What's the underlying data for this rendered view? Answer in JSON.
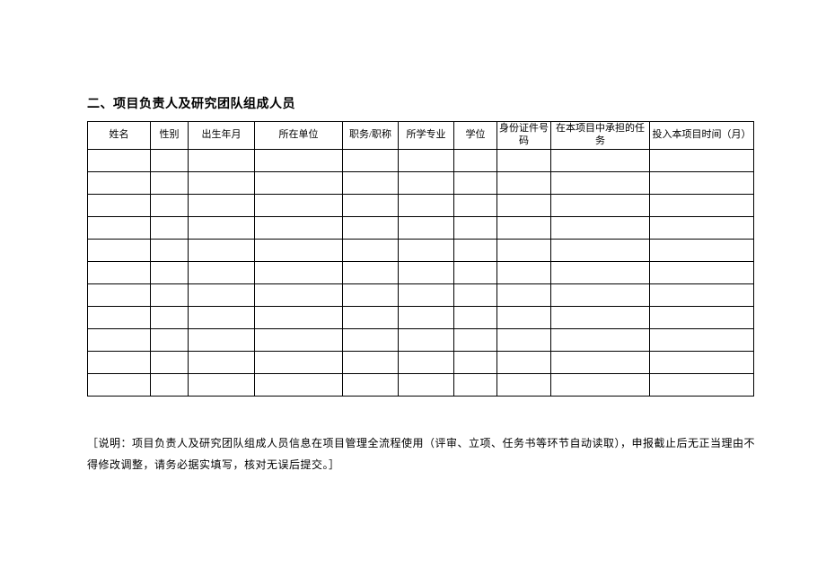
{
  "section_title": "二、项目负责人及研究团队组成人员",
  "headers": {
    "name": "姓名",
    "sex": "性别",
    "dob": "出生年月",
    "unit": "所在单位",
    "position": "职务/职称",
    "major": "所学专业",
    "degree": "学位",
    "idno": "身份证件号码",
    "role": "在本项目中承担的任务",
    "time": "投入本项目时间（月）"
  },
  "rows": [
    {
      "name": "",
      "sex": "",
      "dob": "",
      "unit": "",
      "position": "",
      "major": "",
      "degree": "",
      "idno": "",
      "role": "",
      "time": ""
    },
    {
      "name": "",
      "sex": "",
      "dob": "",
      "unit": "",
      "position": "",
      "major": "",
      "degree": "",
      "idno": "",
      "role": "",
      "time": ""
    },
    {
      "name": "",
      "sex": "",
      "dob": "",
      "unit": "",
      "position": "",
      "major": "",
      "degree": "",
      "idno": "",
      "role": "",
      "time": ""
    },
    {
      "name": "",
      "sex": "",
      "dob": "",
      "unit": "",
      "position": "",
      "major": "",
      "degree": "",
      "idno": "",
      "role": "",
      "time": ""
    },
    {
      "name": "",
      "sex": "",
      "dob": "",
      "unit": "",
      "position": "",
      "major": "",
      "degree": "",
      "idno": "",
      "role": "",
      "time": ""
    },
    {
      "name": "",
      "sex": "",
      "dob": "",
      "unit": "",
      "position": "",
      "major": "",
      "degree": "",
      "idno": "",
      "role": "",
      "time": ""
    },
    {
      "name": "",
      "sex": "",
      "dob": "",
      "unit": "",
      "position": "",
      "major": "",
      "degree": "",
      "idno": "",
      "role": "",
      "time": ""
    },
    {
      "name": "",
      "sex": "",
      "dob": "",
      "unit": "",
      "position": "",
      "major": "",
      "degree": "",
      "idno": "",
      "role": "",
      "time": ""
    },
    {
      "name": "",
      "sex": "",
      "dob": "",
      "unit": "",
      "position": "",
      "major": "",
      "degree": "",
      "idno": "",
      "role": "",
      "time": ""
    },
    {
      "name": "",
      "sex": "",
      "dob": "",
      "unit": "",
      "position": "",
      "major": "",
      "degree": "",
      "idno": "",
      "role": "",
      "time": ""
    },
    {
      "name": "",
      "sex": "",
      "dob": "",
      "unit": "",
      "position": "",
      "major": "",
      "degree": "",
      "idno": "",
      "role": "",
      "time": ""
    }
  ],
  "note_text": "［说明：项目负责人及研究团队组成人员信息在项目管理全流程使用（评审、立项、任务书等环节自动读取），申报截止后无正当理由不得修改调整，请务必据实填写，核对无误后提交。］"
}
